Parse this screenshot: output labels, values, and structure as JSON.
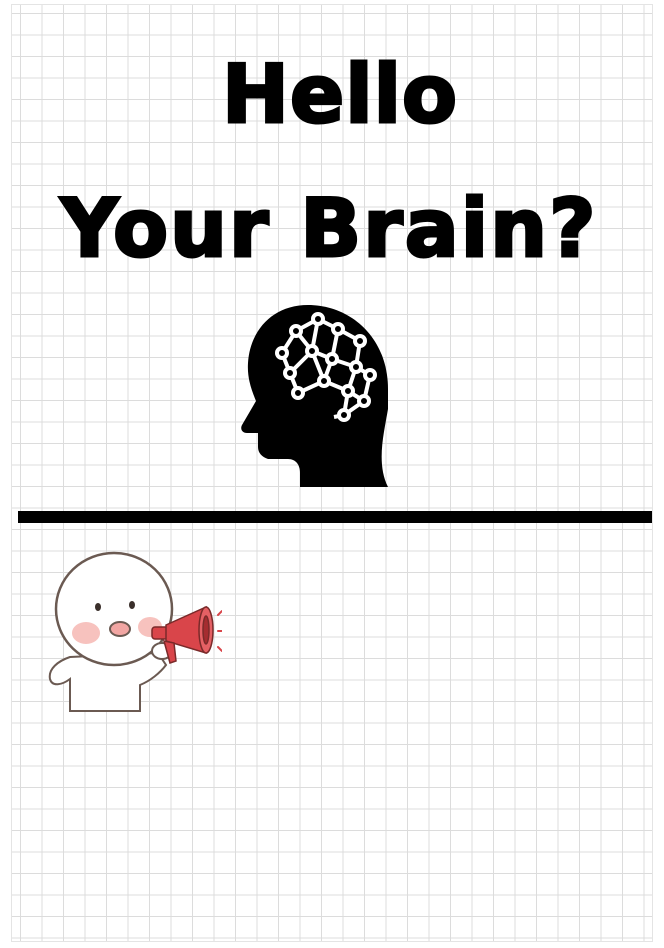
{
  "heading": {
    "line1": "Hello",
    "line2": "Your Brain?"
  },
  "icons": {
    "brain": "brain-network-head-icon",
    "mascot": "megaphone-mascot-icon"
  },
  "colors": {
    "text": "#000000",
    "grid": "#dcdcdc",
    "megaphone": "#d9454a",
    "cheek": "#f6b7b3"
  }
}
